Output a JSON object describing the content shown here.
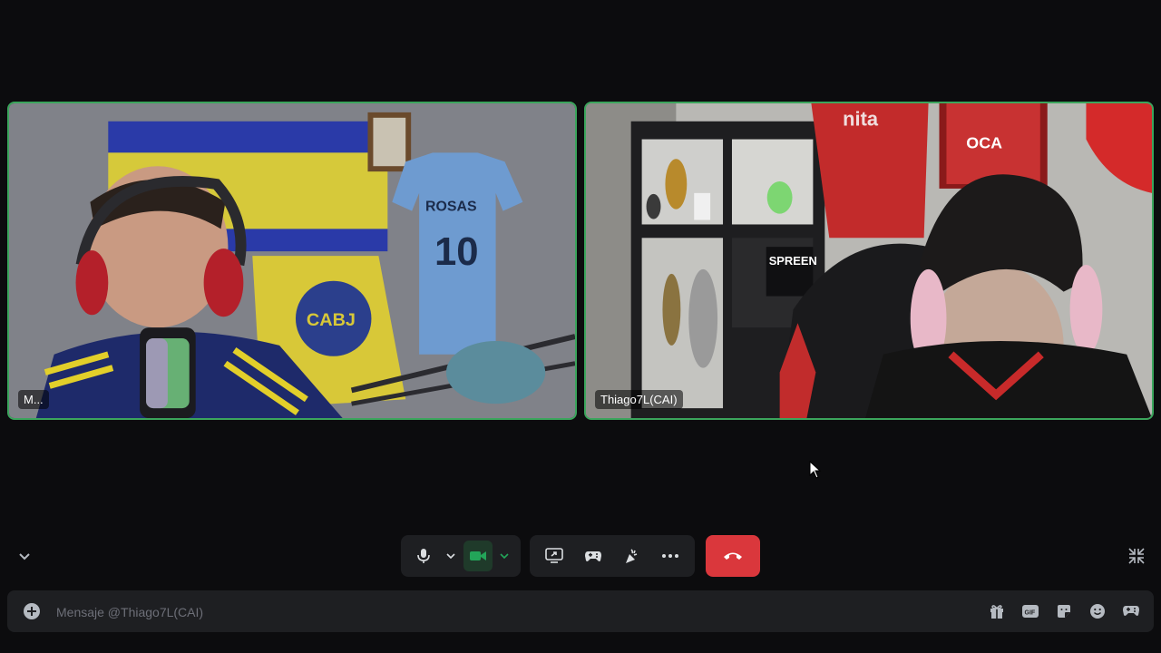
{
  "participants": [
    {
      "name": "M...",
      "speaking": true
    },
    {
      "name": "Thiago7L(CAI)",
      "speaking": true
    }
  ],
  "controls": {
    "mic_icon": "microphone-icon",
    "camera_icon": "video-camera-icon",
    "screen_share_icon": "screen-share-icon",
    "activities_icon": "gamepad-icon",
    "soundboard_icon": "soundboard-icon",
    "more_icon": "more-dots-icon",
    "hangup_icon": "phone-hangup-icon"
  },
  "message": {
    "placeholder": "Mensaje @Thiago7L(CAI)",
    "icons": [
      "gift-icon",
      "gif-icon",
      "sticker-icon",
      "emoji-icon",
      "apps-icon"
    ]
  },
  "colors": {
    "background": "#0c0c0e",
    "panel": "#1e1f22",
    "speaking_border": "#3ba55c",
    "hangup": "#da373c",
    "camera_on": "#23a559"
  }
}
